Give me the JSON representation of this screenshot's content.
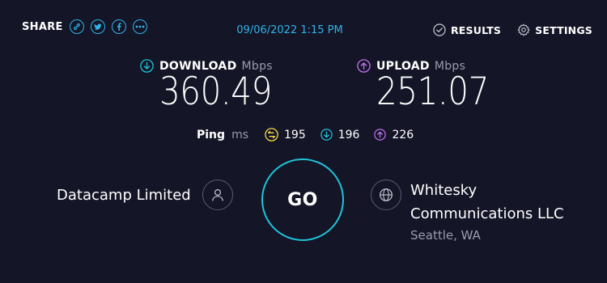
{
  "header": {
    "share_label": "SHARE",
    "social_icons": [
      "link-icon",
      "twitter-icon",
      "facebook-icon",
      "more-icon"
    ],
    "datetime": "09/06/2022 1:15 PM",
    "results_label": "RESULTS",
    "settings_label": "SETTINGS"
  },
  "download": {
    "label": "DOWNLOAD",
    "unit": "Mbps",
    "value": "360.49",
    "color": "#1fc3d9"
  },
  "upload": {
    "label": "UPLOAD",
    "unit": "Mbps",
    "value": "251.07",
    "color": "#bf71f2"
  },
  "ping": {
    "label": "Ping",
    "unit": "ms",
    "idle": "195",
    "download": "196",
    "upload": "226",
    "idle_color": "#f5d94a"
  },
  "provider": {
    "isp_name": "Datacamp Limited",
    "server_name": "Whitesky Communications LLC",
    "server_location": "Seattle, WA"
  },
  "go_button": {
    "label": "GO",
    "ring_color": "#1fc3d9"
  },
  "colors": {
    "background": "#141526",
    "accent_blue": "#2fb3ea",
    "muted_text": "#9a9bb0"
  }
}
